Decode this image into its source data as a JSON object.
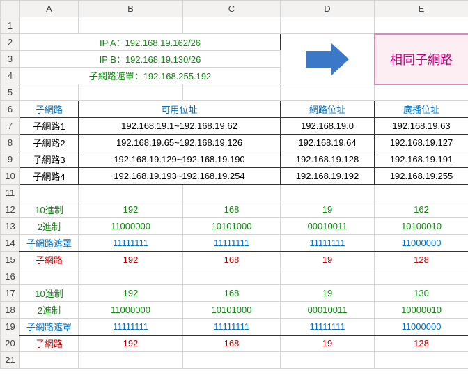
{
  "columns": [
    "A",
    "B",
    "C",
    "D",
    "E"
  ],
  "rows": [
    "1",
    "2",
    "3",
    "4",
    "5",
    "6",
    "7",
    "8",
    "9",
    "10",
    "11",
    "12",
    "13",
    "14",
    "15",
    "16",
    "17",
    "18",
    "19",
    "20",
    "21"
  ],
  "info": {
    "ipA": "IP A：192.168.19.162/26",
    "ipB": "IP B：192.168.19.130/26",
    "mask": "子網路遮罩：192.168.255.192",
    "result": "相同子網路"
  },
  "headers": {
    "subnet": "子網路",
    "usable": "可用位址",
    "network": "網路位址",
    "broadcast": "廣播位址"
  },
  "subnets": [
    {
      "name": "子網路1",
      "range": "192.168.19.1~192.168.19.62",
      "net": "192.168.19.0",
      "bcast": "192.168.19.63"
    },
    {
      "name": "子網路2",
      "range": "192.168.19.65~192.168.19.126",
      "net": "192.168.19.64",
      "bcast": "192.168.19.127"
    },
    {
      "name": "子網路3",
      "range": "192.168.19.129~192.168.19.190",
      "net": "192.168.19.128",
      "bcast": "192.168.19.191"
    },
    {
      "name": "子網路4",
      "range": "192.168.19.193~192.168.19.254",
      "net": "192.168.19.192",
      "bcast": "192.168.19.255"
    }
  ],
  "labels": {
    "dec": "10進制",
    "bin": "2進制",
    "mask": "子網路遮罩",
    "subnet": "子網路"
  },
  "calcA": {
    "dec": [
      "192",
      "168",
      "19",
      "162"
    ],
    "bin": [
      "11000000",
      "10101000",
      "00010011",
      "10100010"
    ],
    "mask": [
      "11111111",
      "11111111",
      "11111111",
      "11000000"
    ],
    "subnet": [
      "192",
      "168",
      "19",
      "128"
    ]
  },
  "calcB": {
    "dec": [
      "192",
      "168",
      "19",
      "130"
    ],
    "bin": [
      "11000000",
      "10101000",
      "00010011",
      "10000010"
    ],
    "mask": [
      "11111111",
      "11111111",
      "11111111",
      "11000000"
    ],
    "subnet": [
      "192",
      "168",
      "19",
      "128"
    ]
  }
}
